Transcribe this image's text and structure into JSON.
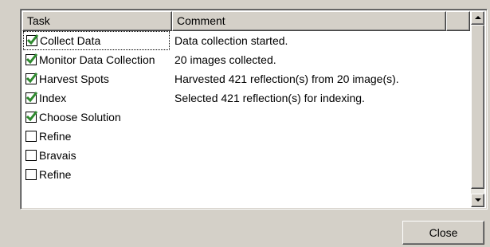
{
  "table": {
    "columns": {
      "task": "Task",
      "comment": "Comment"
    },
    "rows": [
      {
        "task": "Collect Data",
        "comment": "Data collection started.",
        "checked": true
      },
      {
        "task": "Monitor Data Collection",
        "comment": "20 images collected.",
        "checked": true
      },
      {
        "task": "Harvest Spots",
        "comment": "Harvested 421 reflection(s) from 20 image(s).",
        "checked": true
      },
      {
        "task": "Index",
        "comment": "Selected 421 reflection(s) for indexing.",
        "checked": true
      },
      {
        "task": "Choose Solution",
        "comment": "",
        "checked": true
      },
      {
        "task": "Refine",
        "comment": "",
        "checked": false
      },
      {
        "task": "Bravais",
        "comment": "",
        "checked": false
      },
      {
        "task": "Refine",
        "comment": "",
        "checked": false
      }
    ]
  },
  "footer": {
    "close_label": "Close"
  },
  "colors": {
    "check_mark": "#2f8a2f"
  }
}
